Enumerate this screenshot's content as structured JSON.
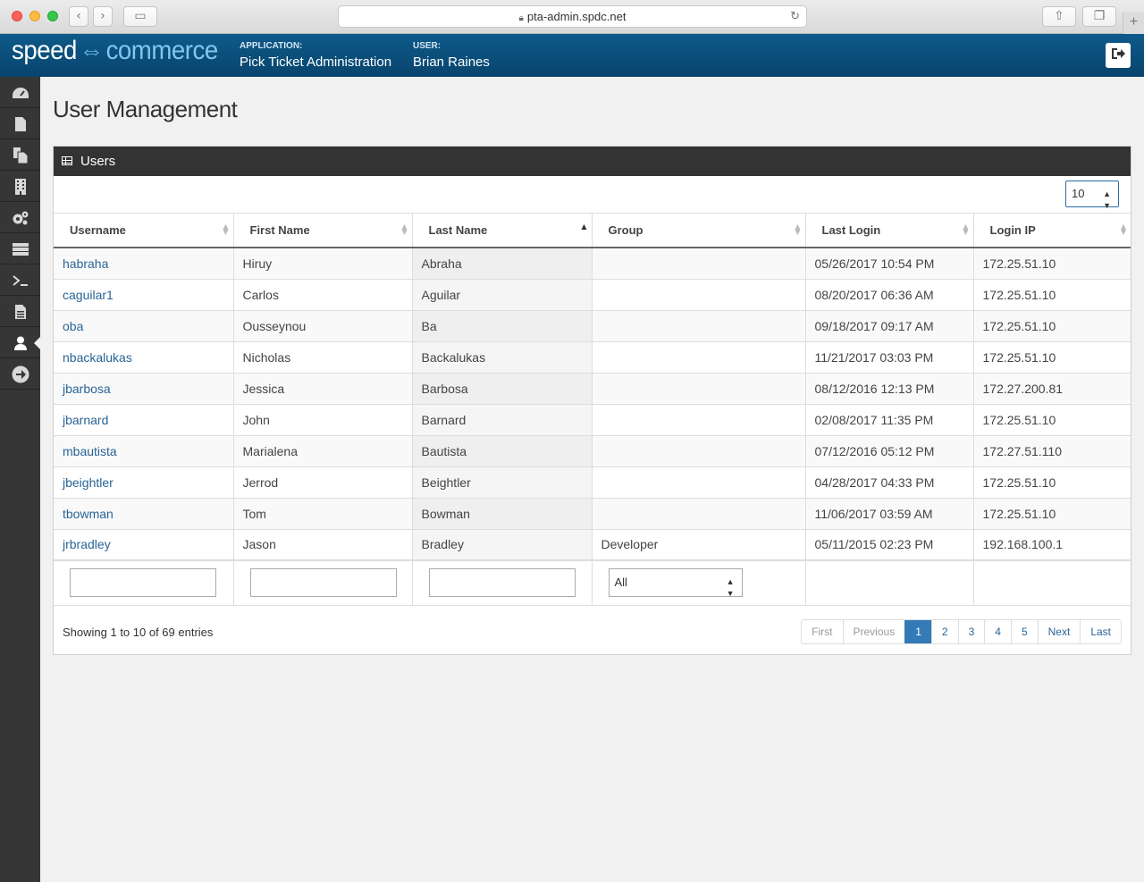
{
  "browser": {
    "url": "pta-admin.spdc.net"
  },
  "header": {
    "logo_left": "speed",
    "logo_right": "commerce",
    "app_label": "APPLICATION:",
    "app_value": "Pick Ticket Administration",
    "user_label": "USER:",
    "user_value": "Brian Raines"
  },
  "sidebar": {
    "items": [
      "dashboard-icon",
      "file-icon",
      "copy-icon",
      "building-icon",
      "cogs-icon",
      "server-icon",
      "terminal-icon",
      "document-icon",
      "user-icon",
      "arrow-circle-icon"
    ],
    "active": "user-icon"
  },
  "page": {
    "title": "User Management"
  },
  "panel": {
    "title": "Users",
    "page_length": "10"
  },
  "table": {
    "columns": [
      "Username",
      "First Name",
      "Last Name",
      "Group",
      "Last Login",
      "Login IP"
    ],
    "sorted_column": "Last Name",
    "rows": [
      [
        "habraha",
        "Hiruy",
        "Abraha",
        "",
        "05/26/2017 10:54 PM",
        "172.25.51.10"
      ],
      [
        "caguilar1",
        "Carlos",
        "Aguilar",
        "",
        "08/20/2017 06:36 AM",
        "172.25.51.10"
      ],
      [
        "oba",
        "Ousseynou",
        "Ba",
        "",
        "09/18/2017 09:17 AM",
        "172.25.51.10"
      ],
      [
        "nbackalukas",
        "Nicholas",
        "Backalukas",
        "",
        "11/21/2017 03:03 PM",
        "172.25.51.10"
      ],
      [
        "jbarbosa",
        "Jessica",
        "Barbosa",
        "",
        "08/12/2016 12:13 PM",
        "172.27.200.81"
      ],
      [
        "jbarnard",
        "John",
        "Barnard",
        "",
        "02/08/2017 11:35 PM",
        "172.25.51.10"
      ],
      [
        "mbautista",
        "Marialena",
        "Bautista",
        "",
        "07/12/2016 05:12 PM",
        "172.27.51.110"
      ],
      [
        "jbeightler",
        "Jerrod",
        "Beightler",
        "",
        "04/28/2017 04:33 PM",
        "172.25.51.10"
      ],
      [
        "tbowman",
        "Tom",
        "Bowman",
        "",
        "11/06/2017 03:59 AM",
        "172.25.51.10"
      ],
      [
        "jrbradley",
        "Jason",
        "Bradley",
        "Developer",
        "05/11/2015 02:23 PM",
        "192.168.100.1"
      ]
    ],
    "group_filter_value": "All"
  },
  "footer": {
    "info": "Showing 1 to 10 of 69 entries",
    "pages": [
      "First",
      "Previous",
      "1",
      "2",
      "3",
      "4",
      "5",
      "Next",
      "Last"
    ],
    "current_page": "1"
  },
  "colors": {
    "header_bg": "#0e5a8a",
    "sidebar_bg": "#363636",
    "link": "#2a6496",
    "active_page": "#337ab7"
  }
}
